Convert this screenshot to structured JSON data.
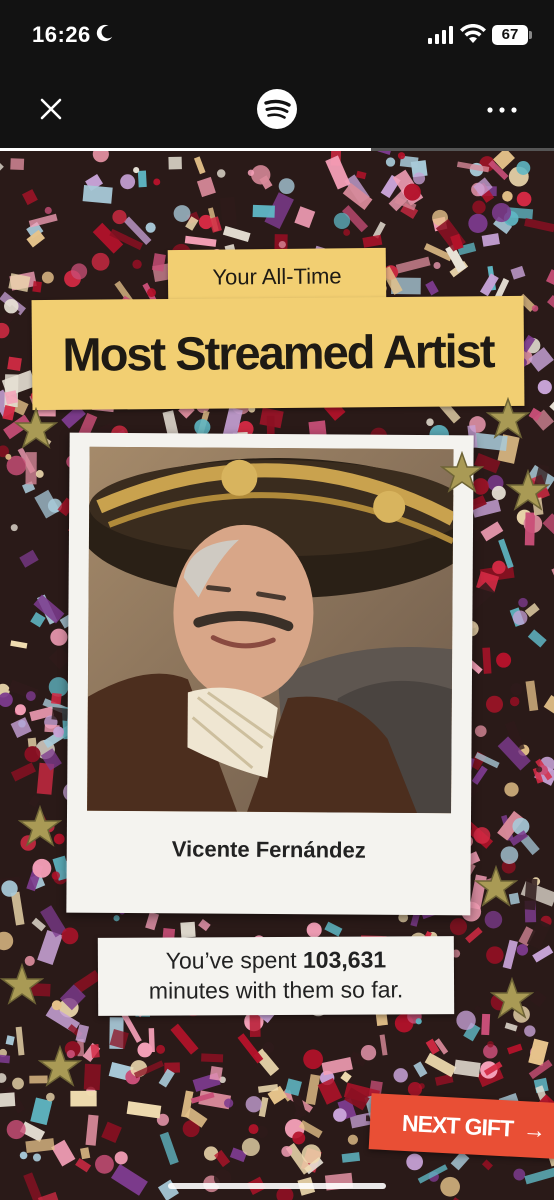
{
  "status_bar": {
    "time": "16:26",
    "battery": "67",
    "icons": [
      "moon-icon",
      "cellular-signal-icon",
      "wifi-icon",
      "battery-icon"
    ]
  },
  "top_nav": {
    "close_icon": "close-icon",
    "logo_icon": "spotify-logo-icon",
    "more_icon": "more-options-icon",
    "story_progress": 0.67
  },
  "story": {
    "heading_small": "Your All-Time",
    "heading_big": "Most Streamed Artist",
    "artist_name": "Vicente Fernández",
    "minutes_text_before": "You’ve spent ",
    "minutes_value": "103,631",
    "minutes_text_after": "minutes with them so far.",
    "next_label": "NEXT GIFT",
    "next_arrow": "→"
  },
  "colors": {
    "label_yellow": "#f2cf72",
    "next_button_red": "#e94f35",
    "paper_white": "#f4f3ef"
  }
}
